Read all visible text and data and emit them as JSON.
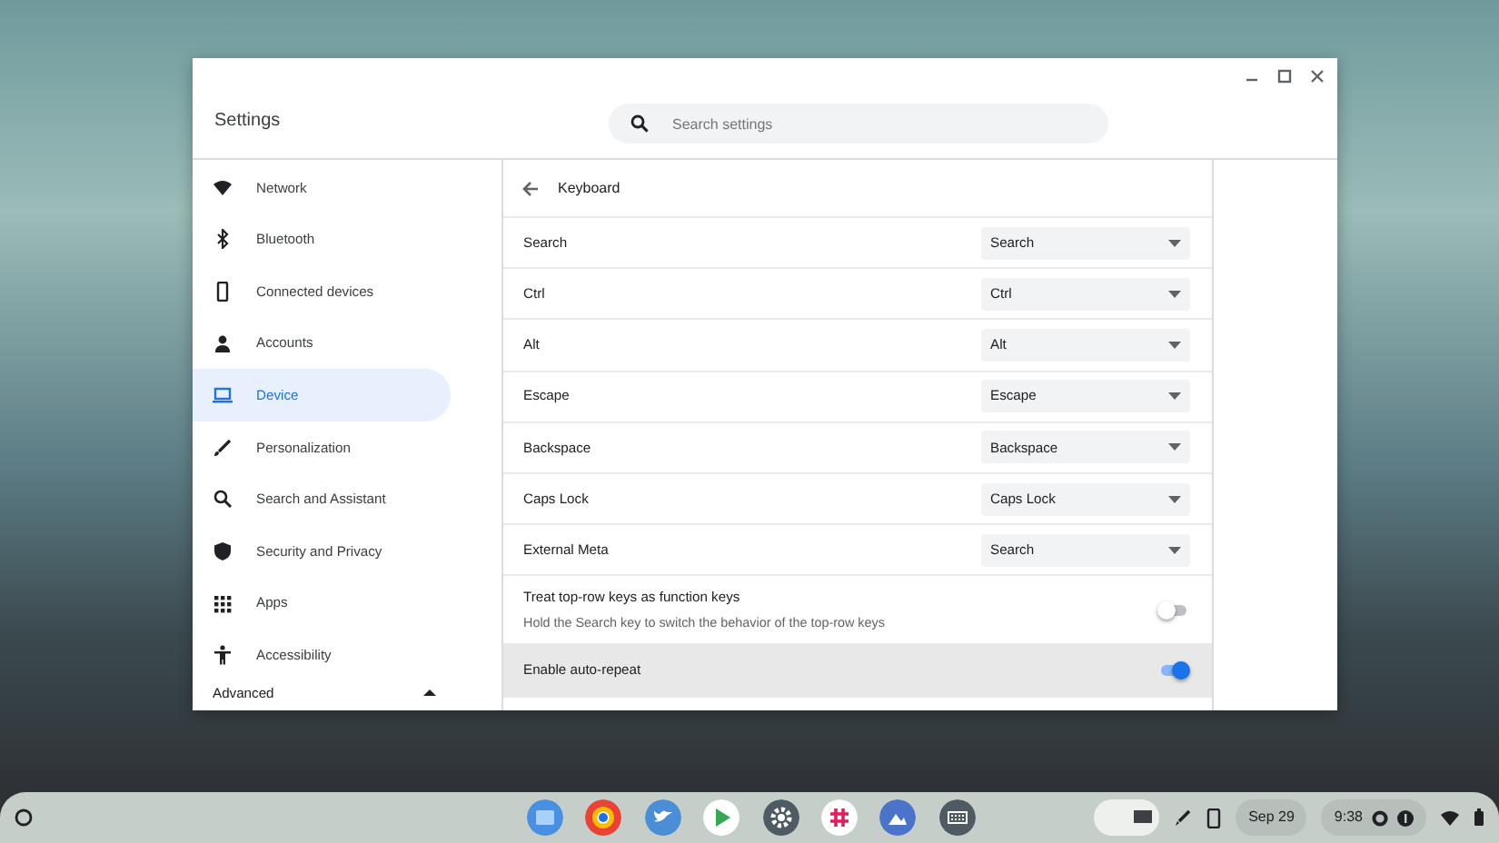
{
  "window": {
    "title": "Settings",
    "search": {
      "placeholder": "Search settings"
    }
  },
  "sidebar": {
    "items": [
      {
        "label": "Network",
        "selected": false
      },
      {
        "label": "Bluetooth",
        "selected": false
      },
      {
        "label": "Connected devices",
        "selected": false
      },
      {
        "label": "Accounts",
        "selected": false
      },
      {
        "label": "Device",
        "selected": true
      },
      {
        "label": "Personalization",
        "selected": false
      },
      {
        "label": "Search and Assistant",
        "selected": false
      },
      {
        "label": "Security and Privacy",
        "selected": false
      },
      {
        "label": "Apps",
        "selected": false
      },
      {
        "label": "Accessibility",
        "selected": false
      }
    ],
    "advanced": {
      "label": "Advanced",
      "expanded": true
    }
  },
  "page": {
    "title": "Keyboard",
    "rows": [
      {
        "kind": "select",
        "label": "Search",
        "value": "Search"
      },
      {
        "kind": "select",
        "label": "Ctrl",
        "value": "Ctrl"
      },
      {
        "kind": "select",
        "label": "Alt",
        "value": "Alt"
      },
      {
        "kind": "select",
        "label": "Escape",
        "value": "Escape"
      },
      {
        "kind": "select",
        "label": "Backspace",
        "value": "Backspace"
      },
      {
        "kind": "select",
        "label": "Caps Lock",
        "value": "Caps Lock"
      },
      {
        "kind": "select",
        "label": "External Meta",
        "value": "Search"
      },
      {
        "kind": "toggle",
        "label": "Treat top-row keys as function keys",
        "description": "Hold the Search key to switch the behavior of the top-row keys",
        "on": false,
        "hovered": false
      },
      {
        "kind": "toggle",
        "label": "Enable auto-repeat",
        "on": true,
        "hovered": true
      }
    ]
  },
  "shelf": {
    "date": "Sep 29",
    "time": "9:38"
  }
}
